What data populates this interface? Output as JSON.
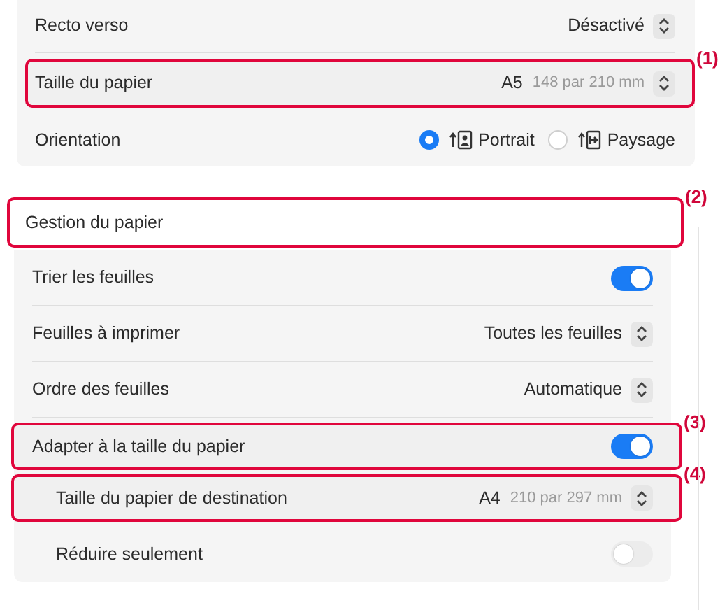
{
  "layout_section": {
    "rows": [
      {
        "kind": "popup",
        "label": "Recto verso",
        "value": "Désactivé",
        "highlighted": false
      },
      {
        "kind": "popup",
        "label": "Taille du papier",
        "value": "A5",
        "detail": "148 par 210 mm",
        "highlighted": true,
        "callout": "(1)"
      },
      {
        "kind": "radio",
        "label": "Orientation",
        "highlighted": false,
        "options": [
          {
            "label": "Portrait",
            "selected": true
          },
          {
            "label": "Paysage",
            "selected": false
          }
        ]
      }
    ]
  },
  "paper_handling": {
    "title": "Gestion du papier",
    "highlighted": true,
    "callout": "(2)",
    "rows": [
      {
        "kind": "toggle",
        "label": "Trier les feuilles",
        "on": true,
        "indented": false,
        "highlighted": false
      },
      {
        "kind": "popup",
        "label": "Feuilles à imprimer",
        "value": "Toutes les feuilles",
        "indented": false,
        "highlighted": false
      },
      {
        "kind": "popup",
        "label": "Ordre des feuilles",
        "value": "Automatique",
        "indented": false,
        "highlighted": false
      },
      {
        "kind": "toggle",
        "label": "Adapter à la taille du papier",
        "on": true,
        "indented": false,
        "highlighted": true,
        "callout": "(3)"
      },
      {
        "kind": "popup",
        "label": "Taille du papier de destination",
        "value": "A4",
        "detail": "210 par 297 mm",
        "indented": true,
        "highlighted": true,
        "callout": "(4)"
      },
      {
        "kind": "toggle",
        "label": "Réduire seulement",
        "on": false,
        "indented": true,
        "highlighted": false
      }
    ]
  }
}
